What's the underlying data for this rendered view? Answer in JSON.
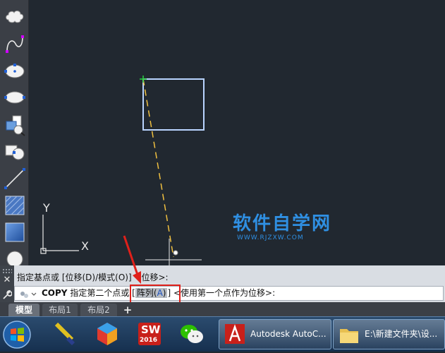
{
  "drawing": {
    "ucs_y": "Y",
    "ucs_x": "X"
  },
  "watermark": {
    "main": "软件自学网",
    "sub": "WWW.RJZXW.COM"
  },
  "command": {
    "history": "指定基点或 [位移(D)/模式(O)] <位移>:",
    "prompt_cmd": "COPY",
    "prompt_text": "指定第二个点或",
    "option_open": "[",
    "option_label": "阵列",
    "option_key_open": "(",
    "option_key": "A",
    "option_key_close": ")",
    "option_close": "]",
    "default_text": "<使用第一个点作为位移>:"
  },
  "tabs": {
    "items": [
      {
        "label": "模型",
        "active": true
      },
      {
        "label": "布局1",
        "active": false
      },
      {
        "label": "布局2",
        "active": false
      }
    ],
    "add_label": "+"
  },
  "taskbar": {
    "sw_label": "SW",
    "sw_year": "2016",
    "autocad_label": "Autodesk AutoC...",
    "explorer_label": "E:\\新建文件夹\\设..."
  },
  "colors": {
    "canvas": "#212830",
    "rectangle": "#b9d4ff",
    "dash_line": "#f0c040",
    "watermark": "#2f8fe2",
    "highlight_box": "#e0201a"
  }
}
